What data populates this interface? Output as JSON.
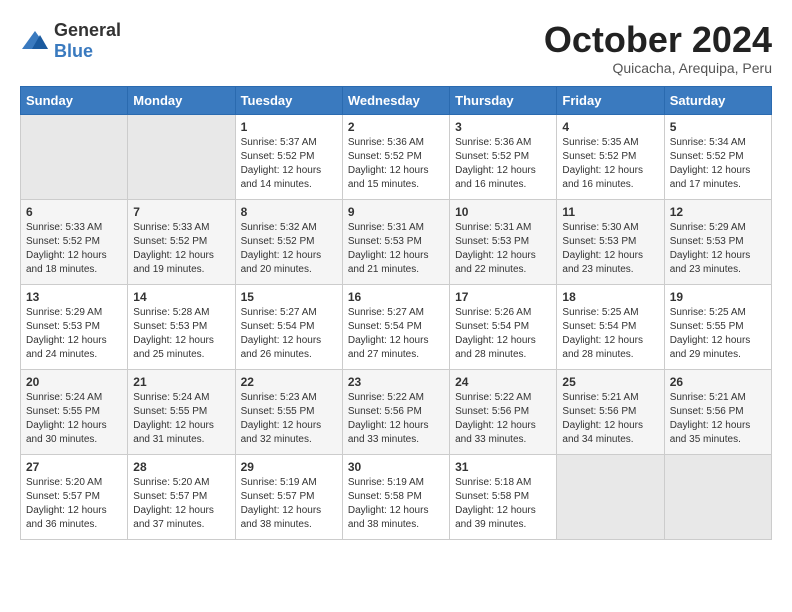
{
  "logo": {
    "general": "General",
    "blue": "Blue"
  },
  "header": {
    "month_year": "October 2024",
    "location": "Quicacha, Arequipa, Peru"
  },
  "weekdays": [
    "Sunday",
    "Monday",
    "Tuesday",
    "Wednesday",
    "Thursday",
    "Friday",
    "Saturday"
  ],
  "weeks": [
    [
      {
        "day": "",
        "sunrise": "",
        "sunset": "",
        "daylight": ""
      },
      {
        "day": "",
        "sunrise": "",
        "sunset": "",
        "daylight": ""
      },
      {
        "day": "1",
        "sunrise": "Sunrise: 5:37 AM",
        "sunset": "Sunset: 5:52 PM",
        "daylight": "Daylight: 12 hours and 14 minutes."
      },
      {
        "day": "2",
        "sunrise": "Sunrise: 5:36 AM",
        "sunset": "Sunset: 5:52 PM",
        "daylight": "Daylight: 12 hours and 15 minutes."
      },
      {
        "day": "3",
        "sunrise": "Sunrise: 5:36 AM",
        "sunset": "Sunset: 5:52 PM",
        "daylight": "Daylight: 12 hours and 16 minutes."
      },
      {
        "day": "4",
        "sunrise": "Sunrise: 5:35 AM",
        "sunset": "Sunset: 5:52 PM",
        "daylight": "Daylight: 12 hours and 16 minutes."
      },
      {
        "day": "5",
        "sunrise": "Sunrise: 5:34 AM",
        "sunset": "Sunset: 5:52 PM",
        "daylight": "Daylight: 12 hours and 17 minutes."
      }
    ],
    [
      {
        "day": "6",
        "sunrise": "Sunrise: 5:33 AM",
        "sunset": "Sunset: 5:52 PM",
        "daylight": "Daylight: 12 hours and 18 minutes."
      },
      {
        "day": "7",
        "sunrise": "Sunrise: 5:33 AM",
        "sunset": "Sunset: 5:52 PM",
        "daylight": "Daylight: 12 hours and 19 minutes."
      },
      {
        "day": "8",
        "sunrise": "Sunrise: 5:32 AM",
        "sunset": "Sunset: 5:52 PM",
        "daylight": "Daylight: 12 hours and 20 minutes."
      },
      {
        "day": "9",
        "sunrise": "Sunrise: 5:31 AM",
        "sunset": "Sunset: 5:53 PM",
        "daylight": "Daylight: 12 hours and 21 minutes."
      },
      {
        "day": "10",
        "sunrise": "Sunrise: 5:31 AM",
        "sunset": "Sunset: 5:53 PM",
        "daylight": "Daylight: 12 hours and 22 minutes."
      },
      {
        "day": "11",
        "sunrise": "Sunrise: 5:30 AM",
        "sunset": "Sunset: 5:53 PM",
        "daylight": "Daylight: 12 hours and 23 minutes."
      },
      {
        "day": "12",
        "sunrise": "Sunrise: 5:29 AM",
        "sunset": "Sunset: 5:53 PM",
        "daylight": "Daylight: 12 hours and 23 minutes."
      }
    ],
    [
      {
        "day": "13",
        "sunrise": "Sunrise: 5:29 AM",
        "sunset": "Sunset: 5:53 PM",
        "daylight": "Daylight: 12 hours and 24 minutes."
      },
      {
        "day": "14",
        "sunrise": "Sunrise: 5:28 AM",
        "sunset": "Sunset: 5:53 PM",
        "daylight": "Daylight: 12 hours and 25 minutes."
      },
      {
        "day": "15",
        "sunrise": "Sunrise: 5:27 AM",
        "sunset": "Sunset: 5:54 PM",
        "daylight": "Daylight: 12 hours and 26 minutes."
      },
      {
        "day": "16",
        "sunrise": "Sunrise: 5:27 AM",
        "sunset": "Sunset: 5:54 PM",
        "daylight": "Daylight: 12 hours and 27 minutes."
      },
      {
        "day": "17",
        "sunrise": "Sunrise: 5:26 AM",
        "sunset": "Sunset: 5:54 PM",
        "daylight": "Daylight: 12 hours and 28 minutes."
      },
      {
        "day": "18",
        "sunrise": "Sunrise: 5:25 AM",
        "sunset": "Sunset: 5:54 PM",
        "daylight": "Daylight: 12 hours and 28 minutes."
      },
      {
        "day": "19",
        "sunrise": "Sunrise: 5:25 AM",
        "sunset": "Sunset: 5:55 PM",
        "daylight": "Daylight: 12 hours and 29 minutes."
      }
    ],
    [
      {
        "day": "20",
        "sunrise": "Sunrise: 5:24 AM",
        "sunset": "Sunset: 5:55 PM",
        "daylight": "Daylight: 12 hours and 30 minutes."
      },
      {
        "day": "21",
        "sunrise": "Sunrise: 5:24 AM",
        "sunset": "Sunset: 5:55 PM",
        "daylight": "Daylight: 12 hours and 31 minutes."
      },
      {
        "day": "22",
        "sunrise": "Sunrise: 5:23 AM",
        "sunset": "Sunset: 5:55 PM",
        "daylight": "Daylight: 12 hours and 32 minutes."
      },
      {
        "day": "23",
        "sunrise": "Sunrise: 5:22 AM",
        "sunset": "Sunset: 5:56 PM",
        "daylight": "Daylight: 12 hours and 33 minutes."
      },
      {
        "day": "24",
        "sunrise": "Sunrise: 5:22 AM",
        "sunset": "Sunset: 5:56 PM",
        "daylight": "Daylight: 12 hours and 33 minutes."
      },
      {
        "day": "25",
        "sunrise": "Sunrise: 5:21 AM",
        "sunset": "Sunset: 5:56 PM",
        "daylight": "Daylight: 12 hours and 34 minutes."
      },
      {
        "day": "26",
        "sunrise": "Sunrise: 5:21 AM",
        "sunset": "Sunset: 5:56 PM",
        "daylight": "Daylight: 12 hours and 35 minutes."
      }
    ],
    [
      {
        "day": "27",
        "sunrise": "Sunrise: 5:20 AM",
        "sunset": "Sunset: 5:57 PM",
        "daylight": "Daylight: 12 hours and 36 minutes."
      },
      {
        "day": "28",
        "sunrise": "Sunrise: 5:20 AM",
        "sunset": "Sunset: 5:57 PM",
        "daylight": "Daylight: 12 hours and 37 minutes."
      },
      {
        "day": "29",
        "sunrise": "Sunrise: 5:19 AM",
        "sunset": "Sunset: 5:57 PM",
        "daylight": "Daylight: 12 hours and 38 minutes."
      },
      {
        "day": "30",
        "sunrise": "Sunrise: 5:19 AM",
        "sunset": "Sunset: 5:58 PM",
        "daylight": "Daylight: 12 hours and 38 minutes."
      },
      {
        "day": "31",
        "sunrise": "Sunrise: 5:18 AM",
        "sunset": "Sunset: 5:58 PM",
        "daylight": "Daylight: 12 hours and 39 minutes."
      },
      {
        "day": "",
        "sunrise": "",
        "sunset": "",
        "daylight": ""
      },
      {
        "day": "",
        "sunrise": "",
        "sunset": "",
        "daylight": ""
      }
    ]
  ]
}
